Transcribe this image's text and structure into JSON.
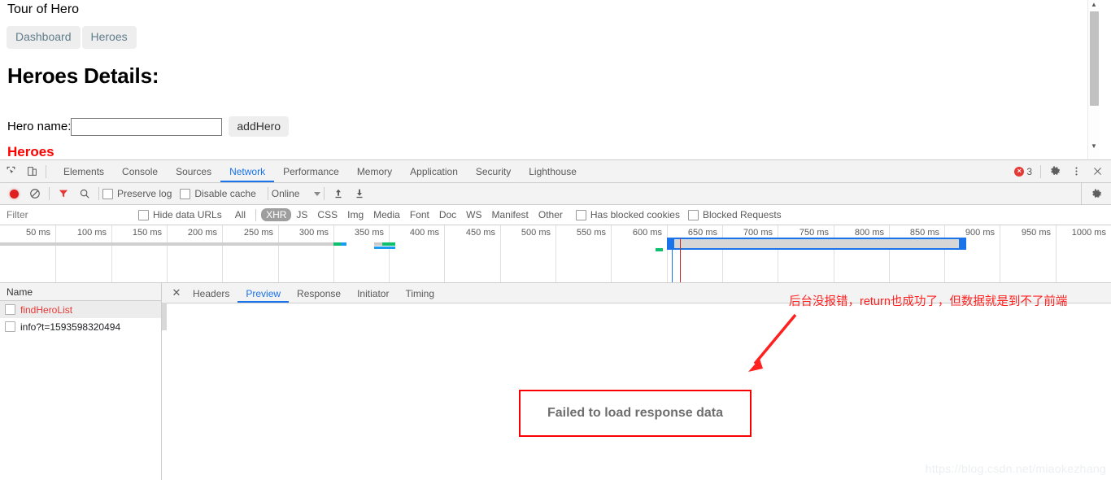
{
  "page": {
    "title": "Tour of Hero",
    "nav": [
      {
        "label": "Dashboard"
      },
      {
        "label": "Heroes"
      }
    ],
    "heading": "Heroes Details:",
    "form": {
      "label": "Hero name:",
      "input_value": "",
      "input_placeholder": "",
      "button_label": "addHero"
    },
    "clipped_text": "Heroes"
  },
  "devtools": {
    "tabs": [
      {
        "label": "Elements",
        "active": false
      },
      {
        "label": "Console",
        "active": false
      },
      {
        "label": "Sources",
        "active": false
      },
      {
        "label": "Network",
        "active": true
      },
      {
        "label": "Performance",
        "active": false
      },
      {
        "label": "Memory",
        "active": false
      },
      {
        "label": "Application",
        "active": false
      },
      {
        "label": "Security",
        "active": false
      },
      {
        "label": "Lighthouse",
        "active": false
      }
    ],
    "error_count": "3",
    "toolbar": {
      "preserve_log": "Preserve log",
      "disable_cache": "Disable cache",
      "throttling": "Online"
    },
    "filterbar": {
      "filter_placeholder": "Filter",
      "hide_data_urls": "Hide data URLs",
      "types": [
        {
          "label": "All",
          "active": false
        },
        {
          "label": "XHR",
          "active": true
        },
        {
          "label": "JS",
          "active": false
        },
        {
          "label": "CSS",
          "active": false
        },
        {
          "label": "Img",
          "active": false
        },
        {
          "label": "Media",
          "active": false
        },
        {
          "label": "Font",
          "active": false
        },
        {
          "label": "Doc",
          "active": false
        },
        {
          "label": "WS",
          "active": false
        },
        {
          "label": "Manifest",
          "active": false
        },
        {
          "label": "Other",
          "active": false
        }
      ],
      "has_blocked_cookies": "Has blocked cookies",
      "blocked_requests": "Blocked Requests"
    },
    "overview": {
      "ticks": [
        "50 ms",
        "100 ms",
        "150 ms",
        "200 ms",
        "250 ms",
        "300 ms",
        "350 ms",
        "400 ms",
        "450 ms",
        "500 ms",
        "550 ms",
        "600 ms",
        "650 ms",
        "700 ms",
        "750 ms",
        "800 ms",
        "850 ms",
        "900 ms",
        "950 ms",
        "1000 ms"
      ],
      "selection_start_ms": 600,
      "selection_end_ms": 870,
      "dom_content_loaded_ms": 605,
      "load_event_ms": 612
    },
    "requests": {
      "column_header": "Name",
      "rows": [
        {
          "name": "findHeroList",
          "failed": true,
          "selected": true
        },
        {
          "name": "info?t=1593598320494",
          "failed": false,
          "selected": false
        }
      ]
    },
    "detail_tabs": [
      {
        "label": "Headers",
        "active": false
      },
      {
        "label": "Preview",
        "active": true
      },
      {
        "label": "Response",
        "active": false
      },
      {
        "label": "Initiator",
        "active": false
      },
      {
        "label": "Timing",
        "active": false
      }
    ],
    "preview_error": "Failed to load response data"
  },
  "annotation": {
    "text": "后台没报错，return也成功了，但数据就是到不了前端",
    "color": "#ff2020"
  },
  "watermark": "https://blog.csdn.net/miaokezhang"
}
